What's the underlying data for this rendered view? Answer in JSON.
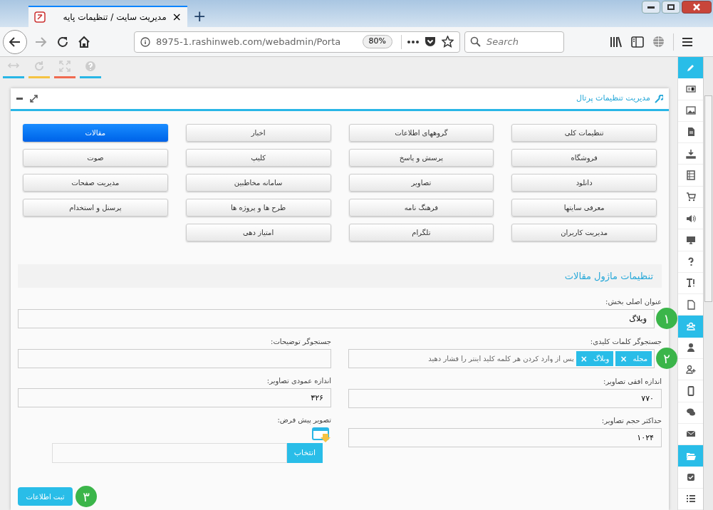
{
  "browser": {
    "tab_title": "مدیریت سایت / تنظیمات پایه",
    "tab_close": "×",
    "new_tab": "+",
    "url": "8975-1.rashinweb.com/webadmin/Porta",
    "zoom": "80%",
    "search": {
      "placeholder": "Search"
    }
  },
  "toolbar": [
    {
      "color": "#29b6e6"
    },
    {
      "color": "#f5c342"
    },
    {
      "color": "#f06a50"
    },
    {
      "color": "#29b6e6"
    }
  ],
  "panel": {
    "title": "مدیریت تنظیمات پرتال",
    "modules": [
      {
        "label": "تنظیمات کلی",
        "selected": false
      },
      {
        "label": "گروههای اطلاعات",
        "selected": false
      },
      {
        "label": "اخبار",
        "selected": false
      },
      {
        "label": "مقالات",
        "selected": true
      },
      {
        "label": "فروشگاه",
        "selected": false
      },
      {
        "label": "پرسش و پاسخ",
        "selected": false
      },
      {
        "label": "کلیپ",
        "selected": false
      },
      {
        "label": "صوت",
        "selected": false
      },
      {
        "label": "دانلود",
        "selected": false
      },
      {
        "label": "تصاویر",
        "selected": false
      },
      {
        "label": "سامانه مخاطبین",
        "selected": false
      },
      {
        "label": "مدیریت صفحات",
        "selected": false
      },
      {
        "label": "معرفی سایتها",
        "selected": false
      },
      {
        "label": "فرهنگ نامه",
        "selected": false
      },
      {
        "label": "طرح ها و پروژه ها",
        "selected": false
      },
      {
        "label": "پرسنل و استخدام",
        "selected": false
      },
      {
        "label": "مدیریت کاربران",
        "selected": false
      },
      {
        "label": "تلگرام",
        "selected": false
      },
      {
        "label": "امتیاز دهی",
        "selected": false
      }
    ],
    "section_title": "تنظیمات ماژول مقالات",
    "main_title": {
      "label": "عنوان اصلی بخش:",
      "value": "وبلاگ",
      "marker": "۱"
    },
    "keywords": {
      "label": "جستجوگر کلمات کلیدی:",
      "tags": [
        "مجله",
        "وبلاگ"
      ],
      "tag_remove": "×",
      "placeholder": "پس از وارد کردن هر کلمه کلید اینتر را فشار دهید",
      "marker": "۲"
    },
    "description_search": {
      "label": "جستجوگر توضیحات:"
    },
    "width": {
      "label": "اندازه افقی تصاویر:",
      "value": "۷۷۰"
    },
    "height": {
      "label": "اندازه عمودی تصاویر:",
      "value": "۳۲۶"
    },
    "max_size": {
      "label": "حداکثر حجم تصاویر:",
      "value": "۱۰۲۴"
    },
    "default_image": {
      "label": "تصویر پیش فرض:",
      "button": "انتخاب"
    },
    "submit": {
      "label": "ثبت اطلاعات",
      "marker": "۳"
    }
  },
  "sidebar": [
    {
      "selected": true
    },
    {
      "selected": false
    },
    {
      "selected": false
    },
    {
      "selected": false
    },
    {
      "selected": false
    },
    {
      "selected": false
    },
    {
      "selected": false
    },
    {
      "selected": false
    },
    {
      "selected": false
    },
    {
      "selected": false
    },
    {
      "selected": false
    },
    {
      "selected": false
    },
    {
      "selected": true
    },
    {
      "selected": false
    },
    {
      "selected": false
    },
    {
      "selected": false
    },
    {
      "selected": false
    },
    {
      "selected": false
    },
    {
      "selected": true
    },
    {
      "selected": false
    },
    {
      "selected": false
    }
  ]
}
